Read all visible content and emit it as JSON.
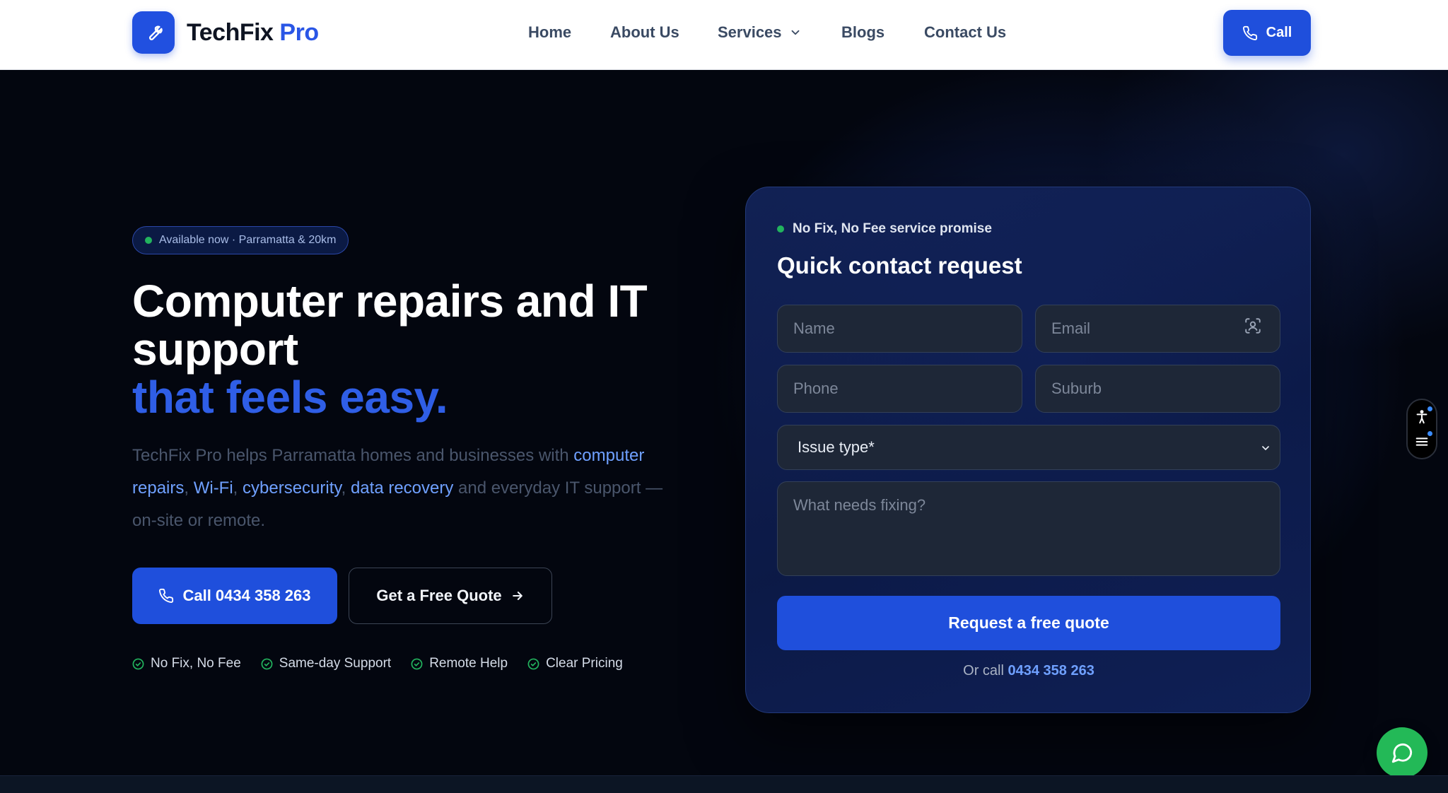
{
  "brand": {
    "name": "TechFix",
    "name_accent": "Pro",
    "logo_icon": "wrench-icon",
    "color": "#2150e0"
  },
  "nav": {
    "items": [
      {
        "label": "Home"
      },
      {
        "label": "About Us"
      },
      {
        "label": "Services",
        "has_dropdown": true
      },
      {
        "label": "Blogs"
      },
      {
        "label": "Contact Us"
      }
    ],
    "call_label": "Call"
  },
  "hero": {
    "badge": "Available now · Parramatta & 20km",
    "headline_line1": "Computer repairs and IT support",
    "headline_accent": "that feels easy.",
    "desc": {
      "intro": "TechFix Pro helps Parramatta homes and businesses with ",
      "links": [
        "computer repairs",
        "Wi-Fi",
        "cybersecurity",
        "data recovery"
      ],
      "sep": ", ",
      "outro": " and everyday IT support — on-site or remote."
    },
    "primary_cta": "Call 0434 358 263",
    "secondary_cta": "Get a Free Quote",
    "features": [
      "No Fix, No Fee",
      "Same-day Support",
      "Remote Help",
      "Clear Pricing"
    ],
    "feature_icon": "check-circle-icon",
    "feature_color": "#22b35e"
  },
  "form": {
    "promise": "No Fix, No Fee service promise",
    "title": "Quick contact request",
    "name_placeholder": "Name",
    "email_placeholder": "Email",
    "phone_placeholder": "Phone",
    "suburb_placeholder": "Suburb",
    "issue_select_value": "Issue type*",
    "message_placeholder": "What needs fixing?",
    "submit_label": "Request a free quote",
    "or_call_prefix": "Or call",
    "or_call_number": "0434 358 263"
  },
  "widgets": {
    "accessibility_icon": "accessibility-icon",
    "menu_icon": "menu-icon",
    "chat_icon": "chat-bubble-icon",
    "chat_color": "#23b957"
  }
}
